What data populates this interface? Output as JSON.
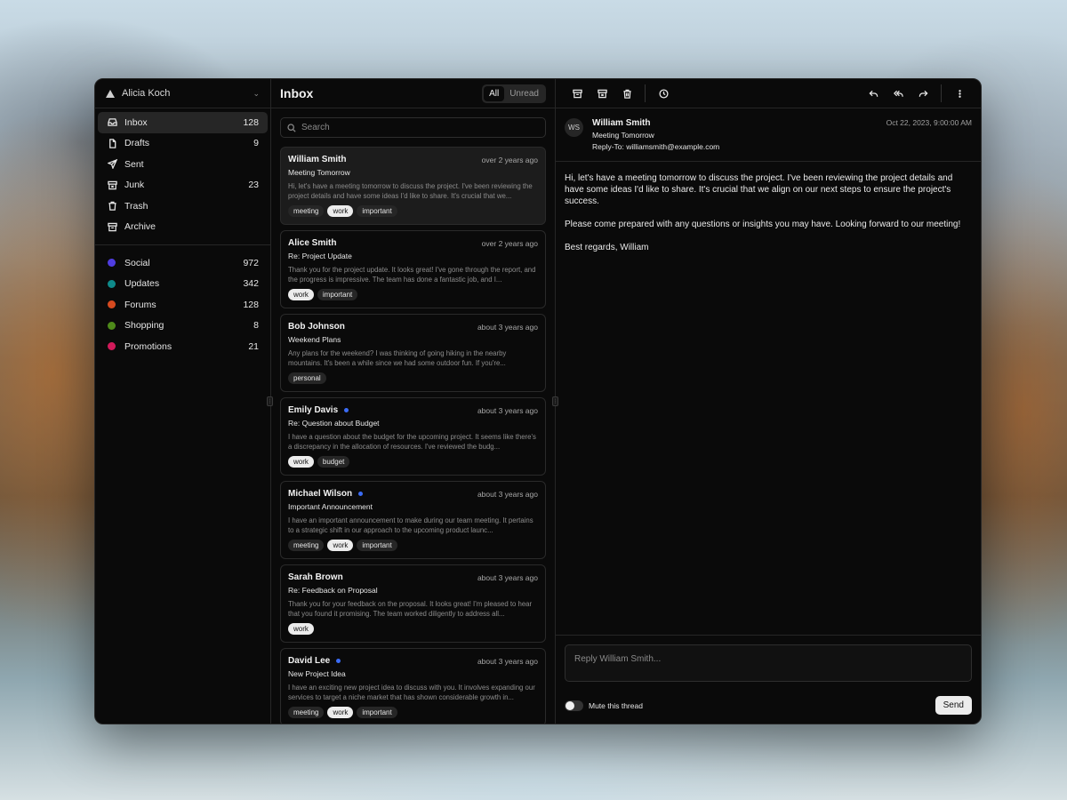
{
  "account": {
    "name": "Alicia Koch"
  },
  "nav": [
    {
      "label": "Inbox",
      "count": "128",
      "icon": "inbox-icon",
      "active": true
    },
    {
      "label": "Drafts",
      "count": "9",
      "icon": "file-icon"
    },
    {
      "label": "Sent",
      "count": "",
      "icon": "send-icon"
    },
    {
      "label": "Junk",
      "count": "23",
      "icon": "archive-x-icon"
    },
    {
      "label": "Trash",
      "count": "",
      "icon": "trash-icon"
    },
    {
      "label": "Archive",
      "count": "",
      "icon": "archive-icon"
    }
  ],
  "categories": [
    {
      "label": "Social",
      "count": "972",
      "color": "#4f3de0"
    },
    {
      "label": "Updates",
      "count": "342",
      "color": "#0e8a8a"
    },
    {
      "label": "Forums",
      "count": "128",
      "color": "#d64a1f"
    },
    {
      "label": "Shopping",
      "count": "8",
      "color": "#4e8a1a"
    },
    {
      "label": "Promotions",
      "count": "21",
      "color": "#d11a5a"
    }
  ],
  "list": {
    "title": "Inbox",
    "filter_all": "All",
    "filter_unread": "Unread",
    "search_placeholder": "Search",
    "mails": [
      {
        "from": "William Smith",
        "time": "over 2 years ago",
        "subject": "Meeting Tomorrow",
        "preview": "Hi, let's have a meeting tomorrow to discuss the project. I've been reviewing the project details and have some ideas I'd like to share. It's crucial that we...",
        "tags": [
          "meeting",
          "work",
          "important"
        ],
        "unread": false,
        "selected": true
      },
      {
        "from": "Alice Smith",
        "time": "over 2 years ago",
        "subject": "Re: Project Update",
        "preview": "Thank you for the project update. It looks great! I've gone through the report, and the progress is impressive. The team has done a fantastic job, and I...",
        "tags": [
          "work",
          "important"
        ],
        "unread": false
      },
      {
        "from": "Bob Johnson",
        "time": "about 3 years ago",
        "subject": "Weekend Plans",
        "preview": "Any plans for the weekend? I was thinking of going hiking in the nearby mountains. It's been a while since we had some outdoor fun. If you're...",
        "tags": [
          "personal"
        ],
        "unread": false
      },
      {
        "from": "Emily Davis",
        "time": "about 3 years ago",
        "subject": "Re: Question about Budget",
        "preview": "I have a question about the budget for the upcoming project. It seems like there's a discrepancy in the allocation of resources. I've reviewed the budg...",
        "tags": [
          "work",
          "budget"
        ],
        "unread": true
      },
      {
        "from": "Michael Wilson",
        "time": "about 3 years ago",
        "subject": "Important Announcement",
        "preview": "I have an important announcement to make during our team meeting. It pertains to a strategic shift in our approach to the upcoming product launc...",
        "tags": [
          "meeting",
          "work",
          "important"
        ],
        "unread": true
      },
      {
        "from": "Sarah Brown",
        "time": "about 3 years ago",
        "subject": "Re: Feedback on Proposal",
        "preview": "Thank you for your feedback on the proposal. It looks great! I'm pleased to hear that you found it promising. The team worked diligently to address all...",
        "tags": [
          "work"
        ],
        "unread": false
      },
      {
        "from": "David Lee",
        "time": "about 3 years ago",
        "subject": "New Project Idea",
        "preview": "I have an exciting new project idea to discuss with you. It involves expanding our services to target a niche market that has shown considerable growth in...",
        "tags": [
          "meeting",
          "work",
          "important"
        ],
        "unread": true
      }
    ]
  },
  "detail": {
    "avatar": "WS",
    "from": "William Smith",
    "subject": "Meeting Tomorrow",
    "reply_to_label": "Reply-To:",
    "reply_to": "williamsmith@example.com",
    "date": "Oct 22, 2023, 9:00:00 AM",
    "body": [
      "Hi, let's have a meeting tomorrow to discuss the project. I've been reviewing the project details and have some ideas I'd like to share. It's crucial that we align on our next steps to ensure the project's success.",
      "Please come prepared with any questions or insights you may have. Looking forward to our meeting!",
      "Best regards, William"
    ],
    "reply_placeholder": "Reply William Smith...",
    "mute_label": "Mute this thread",
    "send_label": "Send"
  }
}
